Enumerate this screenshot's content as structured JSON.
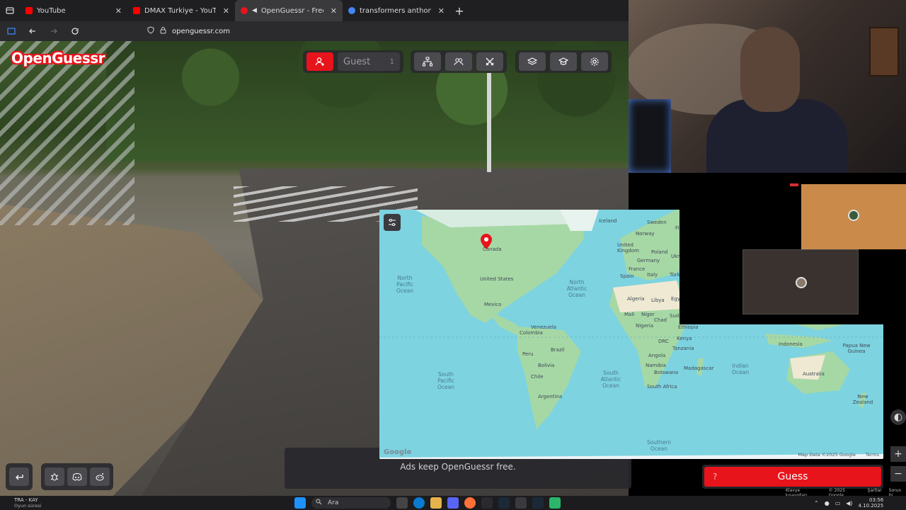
{
  "browser": {
    "tabs": [
      {
        "title": "YouTube",
        "icon": "youtube-icon",
        "color": "#ff0000",
        "active": false
      },
      {
        "title": "DMAX Turkiye - YouTube",
        "icon": "youtube-icon",
        "color": "#ff0000",
        "active": false
      },
      {
        "title": "OpenGuessr - Free GeoGue",
        "icon": "openguessr-icon",
        "color": "#e8141b",
        "active": true
      },
      {
        "title": "transformers anthony hopkins",
        "icon": "google-icon",
        "color": "#4285f4",
        "active": false
      }
    ],
    "url": "openguessr.com"
  },
  "game": {
    "logo": "OpenGuessr",
    "player_name": "Guest",
    "player_count": "1",
    "ads_text": "Ads keep OpenGuessr free.",
    "guess_label": "Guess",
    "guess_hint": "?",
    "footer_credits": [
      "Klavye kısayolları",
      "© 2025 Google",
      "Şartlar",
      "Sorun bi"
    ]
  },
  "map": {
    "pin_label": "Canada",
    "countries": [
      {
        "name": "Iceland"
      },
      {
        "name": "Sweden"
      },
      {
        "name": "Norway"
      },
      {
        "name": "Finland"
      },
      {
        "name": "United Kingdom"
      },
      {
        "name": "Poland"
      },
      {
        "name": "Germany"
      },
      {
        "name": "Ukraine"
      },
      {
        "name": "France"
      },
      {
        "name": "Spain"
      },
      {
        "name": "Italy"
      },
      {
        "name": "Türkiye"
      },
      {
        "name": "United States"
      },
      {
        "name": "Mexico"
      },
      {
        "name": "Venezuela"
      },
      {
        "name": "Colombia"
      },
      {
        "name": "Peru"
      },
      {
        "name": "Brazil"
      },
      {
        "name": "Bolivia"
      },
      {
        "name": "Chile"
      },
      {
        "name": "Argentina"
      },
      {
        "name": "Algeria"
      },
      {
        "name": "Libya"
      },
      {
        "name": "Egypt"
      },
      {
        "name": "Mali"
      },
      {
        "name": "Niger"
      },
      {
        "name": "Chad"
      },
      {
        "name": "Sudan"
      },
      {
        "name": "Nigeria"
      },
      {
        "name": "Ethiopia"
      },
      {
        "name": "DRC"
      },
      {
        "name": "Kenya"
      },
      {
        "name": "Tanzania"
      },
      {
        "name": "Angola"
      },
      {
        "name": "Namibia"
      },
      {
        "name": "Botswana"
      },
      {
        "name": "South Africa"
      },
      {
        "name": "Madagascar"
      },
      {
        "name": "Indonesia"
      },
      {
        "name": "Papua New Guinea"
      },
      {
        "name": "Australia"
      },
      {
        "name": "New Zealand"
      }
    ],
    "oceans": [
      {
        "name": "North Pacific Ocean"
      },
      {
        "name": "North Atlantic Ocean"
      },
      {
        "name": "South Pacific Ocean"
      },
      {
        "name": "South Atlantic Ocean"
      },
      {
        "name": "Indian Ocean"
      },
      {
        "name": "Southern Ocean"
      }
    ],
    "attribution": "Map Data ©2025 Google",
    "terms": "Terms",
    "google": "Google"
  },
  "taskbar": {
    "weather_title": "TRA - KAY",
    "weather_sub": "Oyun süresi",
    "search_label": "Ara",
    "time": "03:56",
    "date": "4.10.2025"
  }
}
